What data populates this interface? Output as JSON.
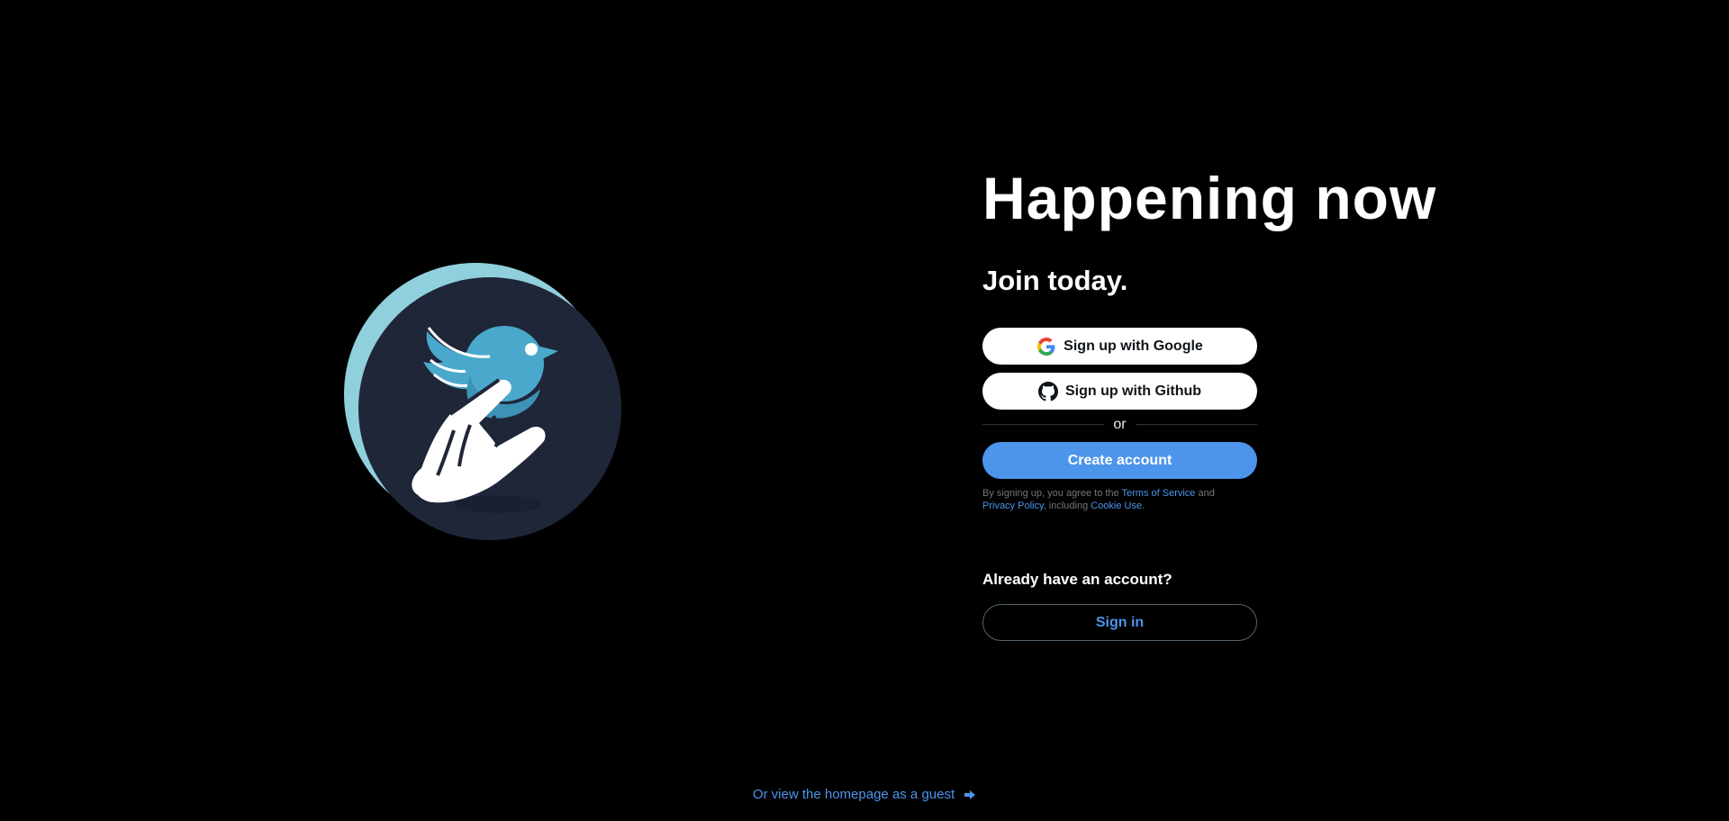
{
  "logo": {
    "icon": "bird-on-hand-logo",
    "colors": {
      "ring": "#8fd0dc",
      "disc": "#1f2638",
      "bird": "#4aa8cc",
      "hand": "#ffffff"
    }
  },
  "hero": {
    "headline": "Happening now",
    "subhead": "Join today."
  },
  "signup": {
    "google_label": "Sign up with Google",
    "github_label": "Sign up with Github",
    "divider_text": "or",
    "create_label": "Create account",
    "terms": {
      "prefix": "By signing up, you agree to the ",
      "tos_link": "Terms of Service",
      "and": " and",
      "privacy_link": "Privacy Policy",
      "including": ", including ",
      "cookie_link": "Cookie Use",
      "suffix": "."
    }
  },
  "signin": {
    "question": "Already have an account?",
    "button_label": "Sign in"
  },
  "guest": {
    "link_text": "Or view the homepage as a guest",
    "icon": "arrow-right-icon"
  },
  "colors": {
    "background": "#000000",
    "accent": "#4d94eb",
    "text": "#ffffff",
    "muted": "#71767b"
  }
}
